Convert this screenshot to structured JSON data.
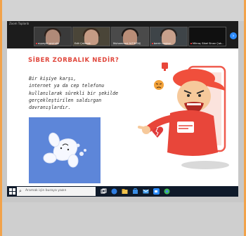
{
  "zoom": {
    "window_title": "Zoom Toplantı",
    "participants": [
      {
        "name": "ayşegül sevindik"
      },
      {
        "name": "Edit Çakmak"
      },
      {
        "name": "Muhammed ALTINTAŞ"
      },
      {
        "name": "berrin coşkun"
      },
      {
        "name": "Mihraç Sibel Sinan Çak..."
      }
    ]
  },
  "slide": {
    "title": "SİBER ZORBALIK NEDİR?",
    "body": "Bir kişiye karşı,\ninternet ya da cep telefonu\nkullanılarak sürekli bir şekilde\ngerçekleştirilen saldırgan\ndavranışlardır."
  },
  "taskbar": {
    "search_placeholder": "Aramak için buraya yazın"
  },
  "colors": {
    "accent_title": "#e0453a",
    "frame_border": "#f2a24a",
    "zoom_bar": "#1c1c1c",
    "taskbar": "#0f1a2a"
  },
  "icons": [
    "windows-start-icon",
    "search-icon",
    "task-view-icon",
    "edge-icon",
    "file-explorer-icon",
    "store-icon",
    "mail-icon",
    "zoom-icon",
    "chrome-icon",
    "angry-emoji-icon",
    "thumbs-down-icon",
    "broken-heart-icon"
  ]
}
